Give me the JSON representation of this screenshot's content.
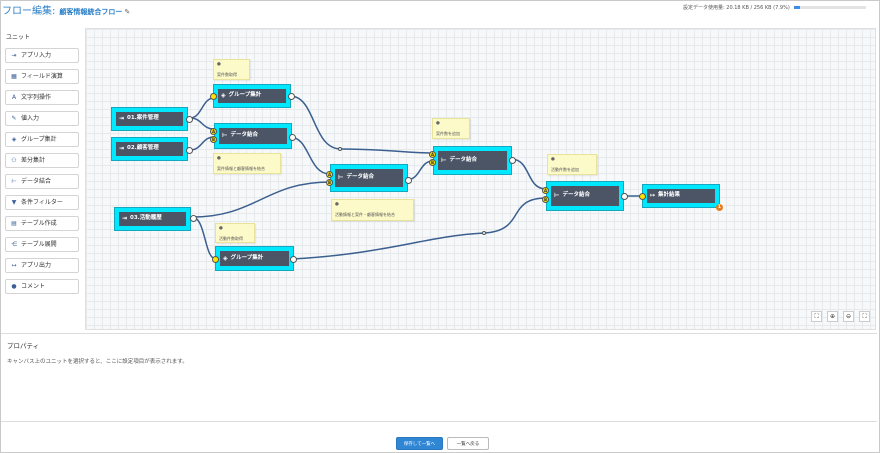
{
  "header": {
    "title": "フロー編集:",
    "flow_name": "顧客情報統合フロー",
    "usage_text": "設定データ使用量: 20.18 KB / 256 KB (7.9%)",
    "usage_fraction": 0.079
  },
  "sidebar": {
    "heading": "ユニット",
    "items": [
      {
        "label": "アプリ入力",
        "icon": "app-input-icon"
      },
      {
        "label": "フィールド演算",
        "icon": "calculator-icon"
      },
      {
        "label": "文字列操作",
        "icon": "text-icon"
      },
      {
        "label": "値入力",
        "icon": "edit-icon"
      },
      {
        "label": "グループ集計",
        "icon": "layers-icon"
      },
      {
        "label": "差分集計",
        "icon": "diff-icon"
      },
      {
        "label": "データ結合",
        "icon": "join-icon"
      },
      {
        "label": "条件フィルター",
        "icon": "filter-icon"
      },
      {
        "label": "テーブル作成",
        "icon": "table-icon"
      },
      {
        "label": "テーブル展開",
        "icon": "expand-icon"
      },
      {
        "label": "アプリ出力",
        "icon": "app-output-icon"
      },
      {
        "label": "コメント",
        "icon": "comment-icon"
      }
    ]
  },
  "canvas": {
    "nodes": {
      "in1": "01.案件管理",
      "in2": "02.顧客管理",
      "in3": "03.活動履歴",
      "group1": "グループ集計",
      "join1": "データ結合",
      "join2": "データ結合",
      "join3": "データ結合",
      "join4": "データ結合",
      "group2": "グループ集計",
      "output": "集計結果"
    },
    "notes": {
      "n1": "案件数取得",
      "n2": "案件情報と顧客情報を結合",
      "n3": "案件数を追加",
      "n4": "活動情報と案件・顧客情報を結合",
      "n5": "活動件数取得",
      "n6": "活動件数を追加"
    },
    "port_labels": {
      "a": "A",
      "b": "B"
    },
    "error_badge": "1"
  },
  "properties": {
    "heading": "プロパティ",
    "hint": "キャンバス上のユニットを選択すると、ここに設定項目が表示されます。"
  },
  "footer": {
    "save_label": "保存して一覧へ",
    "back_label": "一覧へ戻る"
  }
}
